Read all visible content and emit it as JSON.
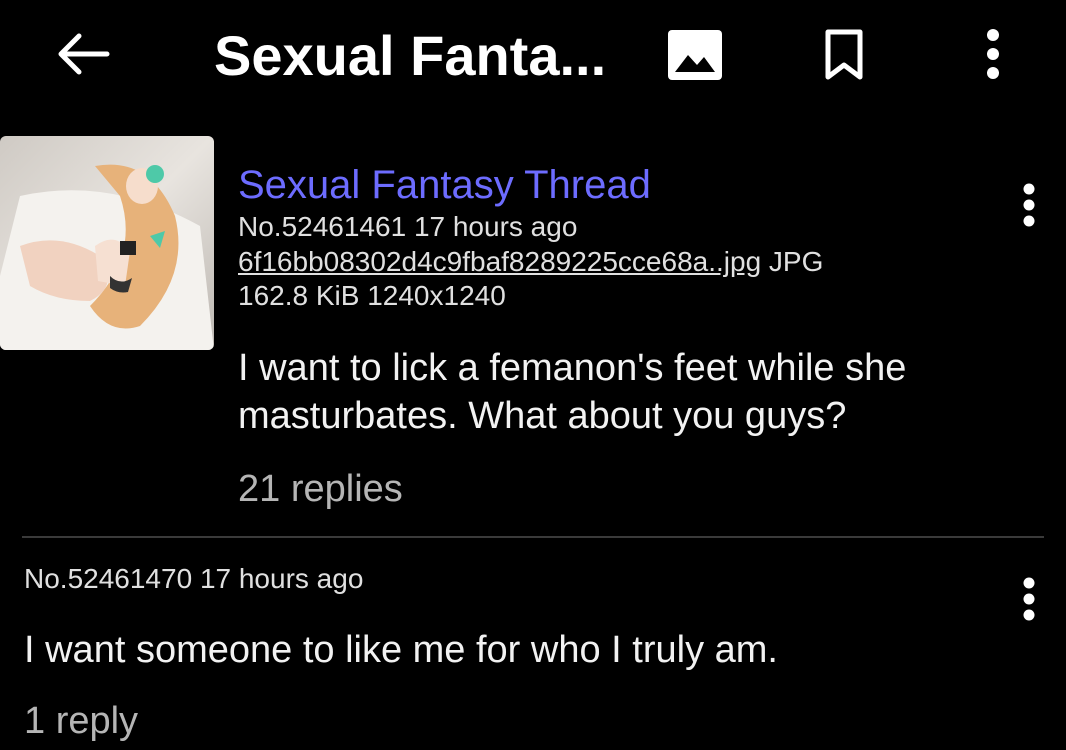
{
  "appbar": {
    "title": "Sexual Fanta...",
    "back_icon": "arrow-left-icon",
    "image_icon": "image-icon",
    "bookmark_icon": "bookmark-icon",
    "more_icon": "more-vertical-icon"
  },
  "op": {
    "subject": "Sexual Fantasy Thread",
    "post_number": "No.52461461",
    "time": "17 hours ago",
    "filename": "6f16bb08302d4c9fbaf8289225cce68a..jpg",
    "filetype": "JPG",
    "filesize": "162.8 KiB",
    "dimensions": "1240x1240",
    "comment": "I want to lick a femanon's feet while she masturbates. What about you guys?",
    "replies": "21 replies"
  },
  "reply": {
    "post_number": "No.52461470",
    "time": "17 hours ago",
    "comment": "I want someone to like me for who I truly am.",
    "replies": "1 reply"
  },
  "colors": {
    "background": "#000000",
    "subject": "#6d6cff",
    "text": "#e6e6e6",
    "muted": "#b5b5b5",
    "divider": "#3a3a3a"
  }
}
